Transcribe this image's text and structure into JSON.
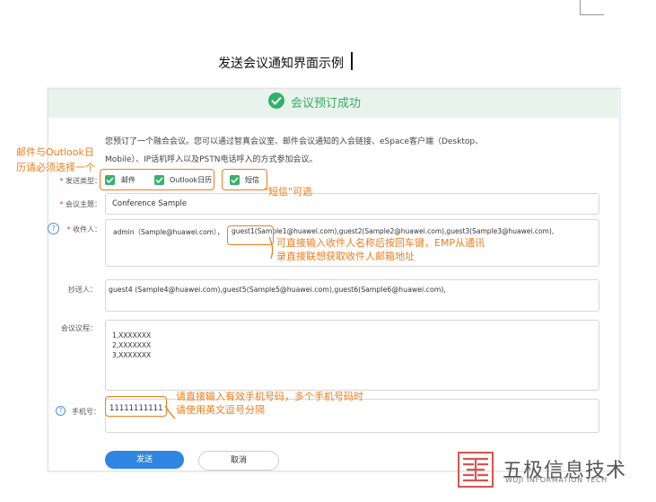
{
  "doc_title": "发送会议通知界面示例",
  "banner": {
    "text": "会议预订成功"
  },
  "intro": {
    "line1": "您预订了一个融合会议。您可以通过智真会议室、邮件会议通知的入会链接、eSpace客户端（Desktop、",
    "line2": "Mobile）、IP话机呼入以及PSTN电话呼入的方式参加会议。"
  },
  "form": {
    "send_type_label": "发送类型：",
    "send_types": [
      "邮件",
      "Outlook日历",
      "短信"
    ],
    "subject_label": "会议主题：",
    "subject_value": "Conference Sample",
    "recipients_label": "收件人：",
    "recipients_prefix": "admin（Sample@huawei.com），",
    "recipients_value": "guest1(Sample1@huawei.com),guest2(Sample2@huawei.com),guest3(Sample3@huawei.com),",
    "cc_label": "抄送人：",
    "cc_value": "guest4 (Sample4@huawei.com),guest5(Sample5@huawei.com),guest6(Sample6@huawei.com),",
    "agenda_label": "会议议程：",
    "agenda_lines": [
      "1,XXXXXXX",
      "2,XXXXXXX",
      "3,XXXXXXX"
    ],
    "phone_label": "手机号：",
    "phone_value": "11111111111"
  },
  "buttons": {
    "send": "发送",
    "cancel": "取消"
  },
  "annotations": {
    "mail_outlook_1": "邮件与Outlook日",
    "mail_outlook_2": "历请必须选择一个",
    "sms_optional": "\"短信\"可选",
    "recipients_1": "可直接输入收件人名称后按回车键，EMP从通讯",
    "recipients_2": "录直接联想获取收件人邮箱地址",
    "phone_1": "请直接输入有效手机号码，多个手机号码时",
    "phone_2": "请使用英文逗号分隔"
  },
  "logo": {
    "cn": "五极信息技术",
    "en": "WUJI INFORMATION TECH"
  },
  "colors": {
    "accent_green": "#37b26a",
    "annotation_orange": "#f07c1e",
    "primary_blue": "#2f86e0"
  }
}
